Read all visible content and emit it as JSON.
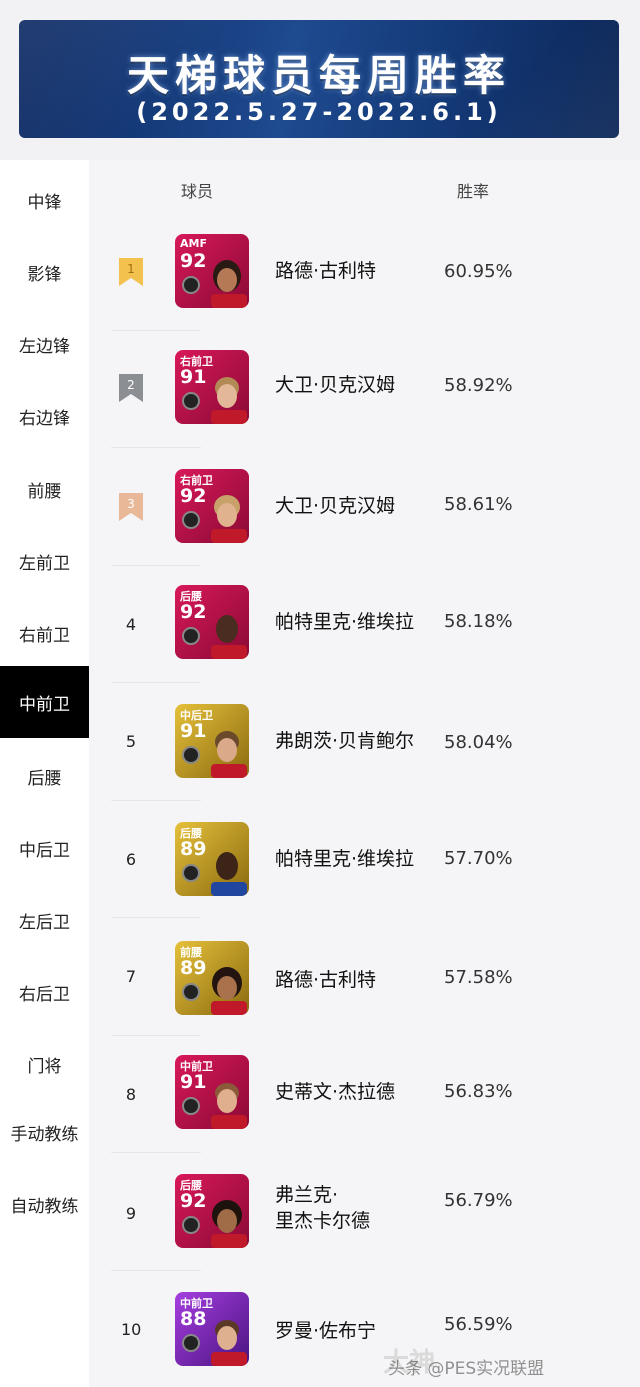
{
  "header": {
    "title": "天梯球员每周胜率",
    "date_range": "(2022.5.27-2022.6.1)"
  },
  "sidebar": {
    "items": [
      {
        "label": "中锋"
      },
      {
        "label": "影锋"
      },
      {
        "label": "左边锋"
      },
      {
        "label": "右边锋"
      },
      {
        "label": "前腰"
      },
      {
        "label": "左前卫"
      },
      {
        "label": "右前卫"
      },
      {
        "label": "中前卫",
        "active": true
      },
      {
        "label": "后腰"
      },
      {
        "label": "中后卫"
      },
      {
        "label": "左后卫"
      },
      {
        "label": "右后卫"
      },
      {
        "label": "门将"
      },
      {
        "label": "手动教练"
      },
      {
        "label": "自动教练"
      }
    ]
  },
  "table": {
    "col_player": "球员",
    "col_winrate": "胜率",
    "rows": [
      {
        "rank": "1",
        "position": "AMF",
        "rating": "92",
        "name": "路德·古利特",
        "win_rate": "60.95%",
        "card_color": "#c8104f",
        "medal": "gold"
      },
      {
        "rank": "2",
        "position": "右前卫",
        "rating": "91",
        "name": "大卫·贝克汉姆",
        "win_rate": "58.92%",
        "card_color": "#c8104f",
        "medal": "silver"
      },
      {
        "rank": "3",
        "position": "右前卫",
        "rating": "92",
        "name": "大卫·贝克汉姆",
        "win_rate": "58.61%",
        "card_color": "#c8104f",
        "medal": "bronze"
      },
      {
        "rank": "4",
        "position": "后腰",
        "rating": "92",
        "name": "帕特里克·维埃拉",
        "win_rate": "58.18%",
        "card_color": "#c8104f"
      },
      {
        "rank": "5",
        "position": "中后卫",
        "rating": "91",
        "name": "弗朗茨·贝肯鲍尔",
        "win_rate": "58.04%",
        "card_color": "#c9a21a"
      },
      {
        "rank": "6",
        "position": "后腰",
        "rating": "89",
        "name": "帕特里克·维埃拉",
        "win_rate": "57.70%",
        "card_color": "#c9a21a"
      },
      {
        "rank": "7",
        "position": "前腰",
        "rating": "89",
        "name": "路德·古利特",
        "win_rate": "57.58%",
        "card_color": "#c9a21a"
      },
      {
        "rank": "8",
        "position": "中前卫",
        "rating": "91",
        "name": "史蒂文·杰拉德",
        "win_rate": "56.83%",
        "card_color": "#c8104f"
      },
      {
        "rank": "9",
        "position": "后腰",
        "rating": "92",
        "name_line1": "弗兰克·",
        "name_line2": "里杰卡尔德",
        "win_rate": "56.79%",
        "card_color": "#c8104f"
      },
      {
        "rank": "10",
        "position": "中前卫",
        "rating": "88",
        "name": "罗曼·佐布宁",
        "win_rate": "56.59%",
        "card_color": "#8e2ad0"
      }
    ]
  },
  "watermark": {
    "text": "头条 @PES实况联盟",
    "overlay": "大神"
  },
  "colors": {
    "banner": "#1e4a8f",
    "gold_medal": "#f2c14e",
    "silver_medal": "#8b8e93",
    "bronze_medal": "#e8b898",
    "active_tab": "#000000"
  }
}
